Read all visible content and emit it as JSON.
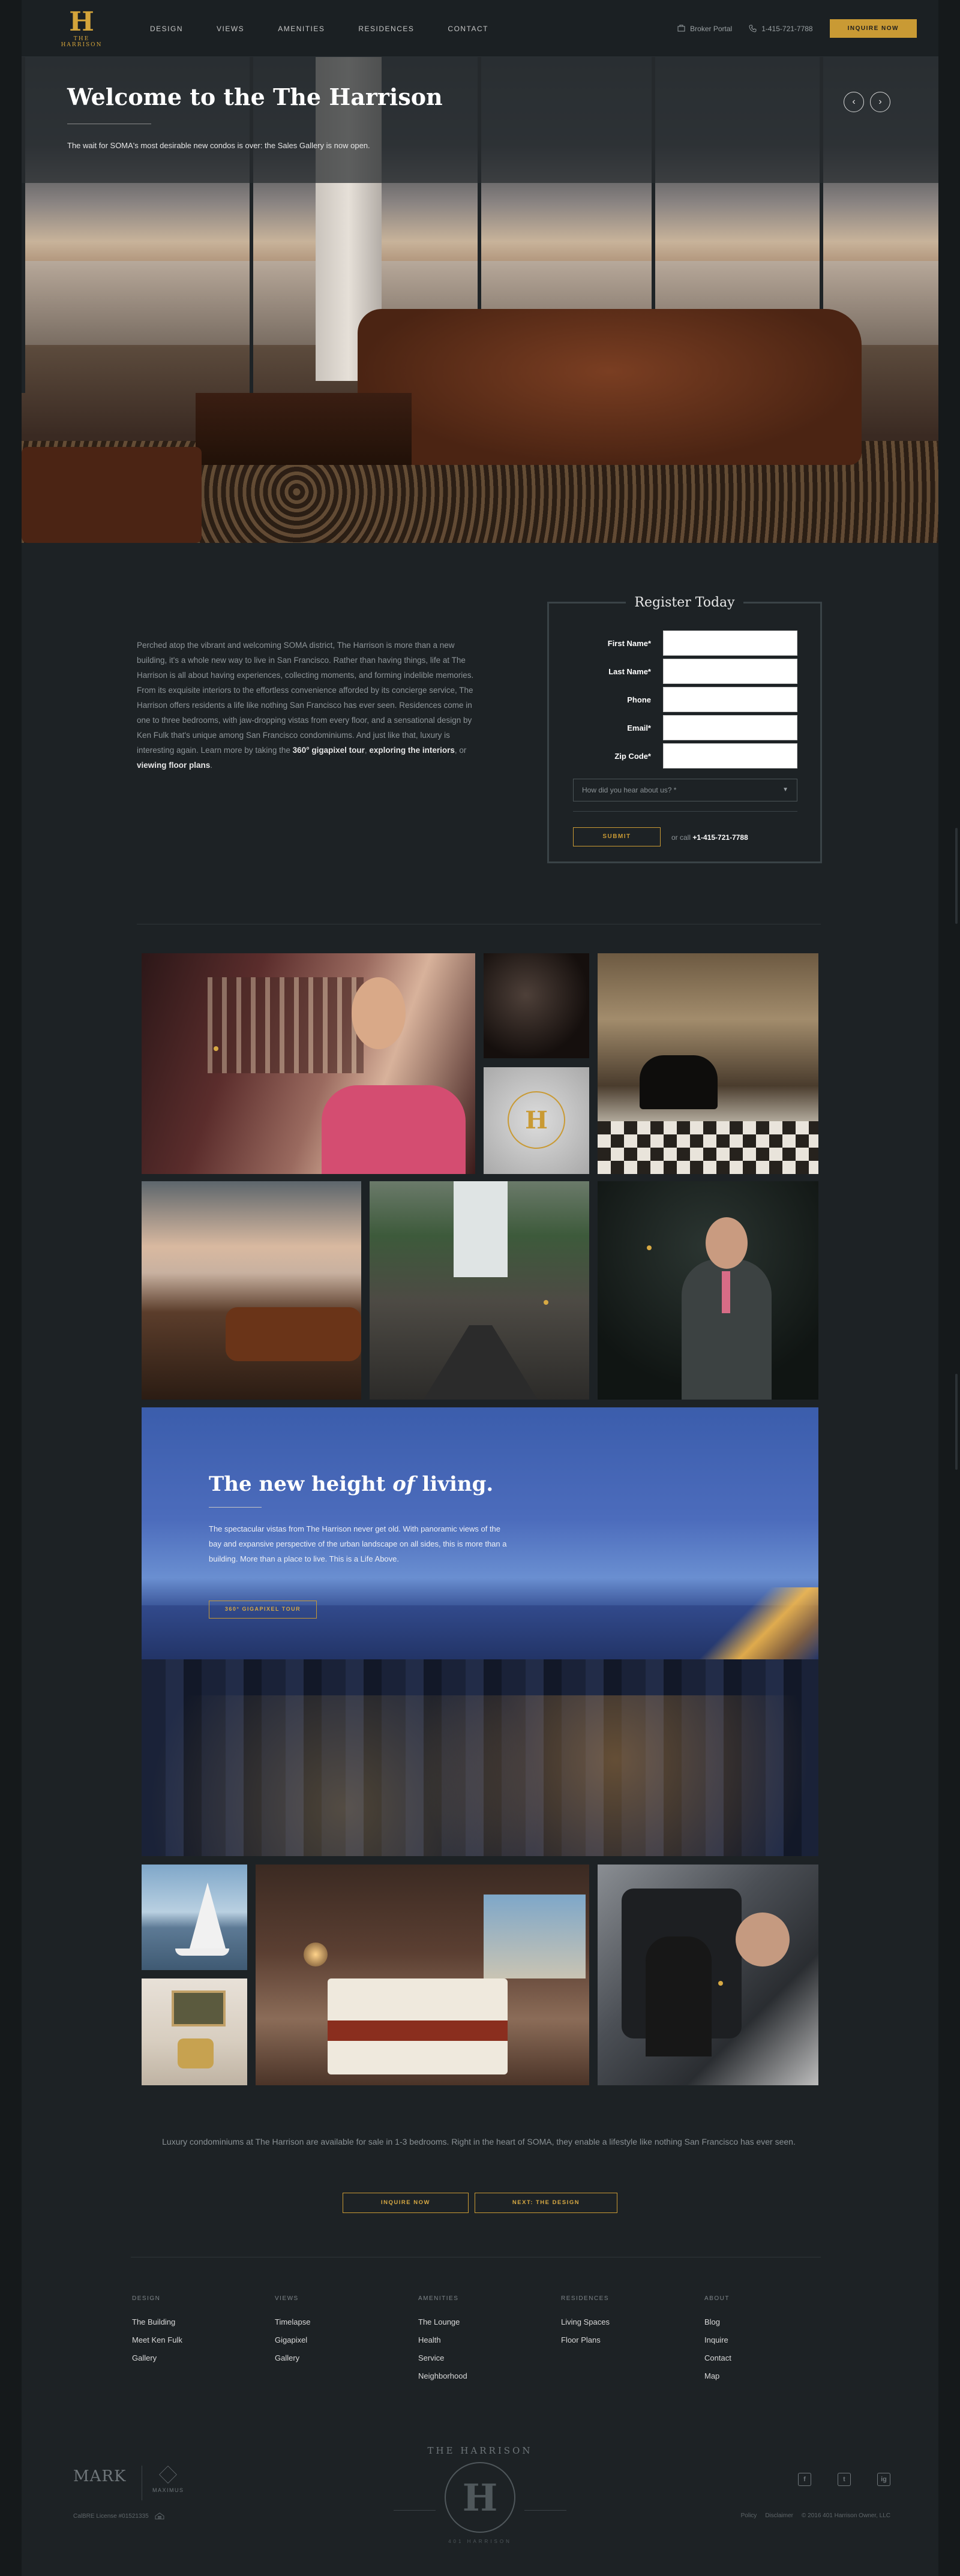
{
  "brand": {
    "logo_letter": "H",
    "logo_text": "THE HARRISON",
    "accent": "#c99a34",
    "background": "#1d2225"
  },
  "nav": {
    "items": [
      "DESIGN",
      "VIEWS",
      "AMENITIES",
      "RESIDENCES",
      "CONTACT"
    ]
  },
  "header_right": {
    "broker": "Broker Portal",
    "phone": "1-415-721-7788",
    "cta": "INQUIRE NOW"
  },
  "hero": {
    "title": "Welcome to the The Harrison",
    "subtitle": "The wait for SOMA's most desirable new condos is over: the Sales Gallery is now open.",
    "prev_icon": "‹",
    "next_icon": "›"
  },
  "intro": {
    "text_1": "Perched atop the vibrant and welcoming SOMA district, The Harrison is more than a new building, it's a whole new way to live in San Francisco. Rather than having things, life at The Harrison is all about having experiences, collecting moments, and forming indelible memories. From its exquisite interiors to the effortless convenience afforded by its concierge service, The Harrison offers residents a life like nothing San Francisco has ever seen. Residences come in one to three bedrooms, with jaw-dropping vistas from every floor, and a sensational design by Ken Fulk that's unique among San Francisco condominiums. And just like that, luxury is interesting again. Learn more by taking the ",
    "link_1": "360° gigapixel tour",
    "sep_1": ", ",
    "link_2": "exploring the interiors",
    "sep_2": ", or ",
    "link_3": "viewing floor plans",
    "end": "."
  },
  "register": {
    "title": "Register Today",
    "fields": [
      "First Name*",
      "Last Name*",
      "Phone",
      "Email*",
      "Zip Code*"
    ],
    "select_placeholder": "How did you hear about us? *",
    "submit": "SUBMIT",
    "call_prefix": "or call",
    "call_number": "+1-415-721-7788"
  },
  "city": {
    "title_1": "The new height ",
    "title_em": "of",
    "title_2": " living.",
    "text": "The spectacular vistas from The Harrison never get old. With panoramic views of the bay and expansive perspective of the urban landscape on all sides, this is more than a building. More than a place to live. This is a Life Above.",
    "button": "360° GIGAPIXEL TOUR"
  },
  "gallery_logo_letter": "H",
  "bottom": {
    "text": "Luxury condominiums at The Harrison are available for sale in 1-3 bedrooms. Right in the heart of SOMA, they enable a lifestyle like nothing San Francisco has ever seen.",
    "btn_inquire": "INQUIRE NOW",
    "btn_next": "NEXT: THE DESIGN"
  },
  "footer": {
    "columns": [
      {
        "title": "DESIGN",
        "links": [
          "The Building",
          "Meet Ken Fulk",
          "Gallery"
        ]
      },
      {
        "title": "VIEWS",
        "links": [
          "Timelapse",
          "Gigapixel",
          "Gallery"
        ]
      },
      {
        "title": "AMENITIES",
        "links": [
          "The Lounge",
          "Health",
          "Service",
          "Neighborhood"
        ]
      },
      {
        "title": "RESIDENCES",
        "links": [
          "Living Spaces",
          "Floor Plans"
        ]
      },
      {
        "title": "ABOUT",
        "links": [
          "Blog",
          "Inquire",
          "Contact",
          "Map"
        ]
      }
    ],
    "mark_logo": "MARK",
    "maximus": "MAXIMUS",
    "license": "CalBRE License #01521335",
    "emblem_name": "THE HARRISON",
    "emblem_letter": "H",
    "emblem_sub": "401 HARRISON",
    "social": [
      "f",
      "t",
      "ig"
    ],
    "legal": [
      "Policy",
      "Disclaimer",
      "© 2016 401 Harrison Owner, LLC"
    ]
  }
}
